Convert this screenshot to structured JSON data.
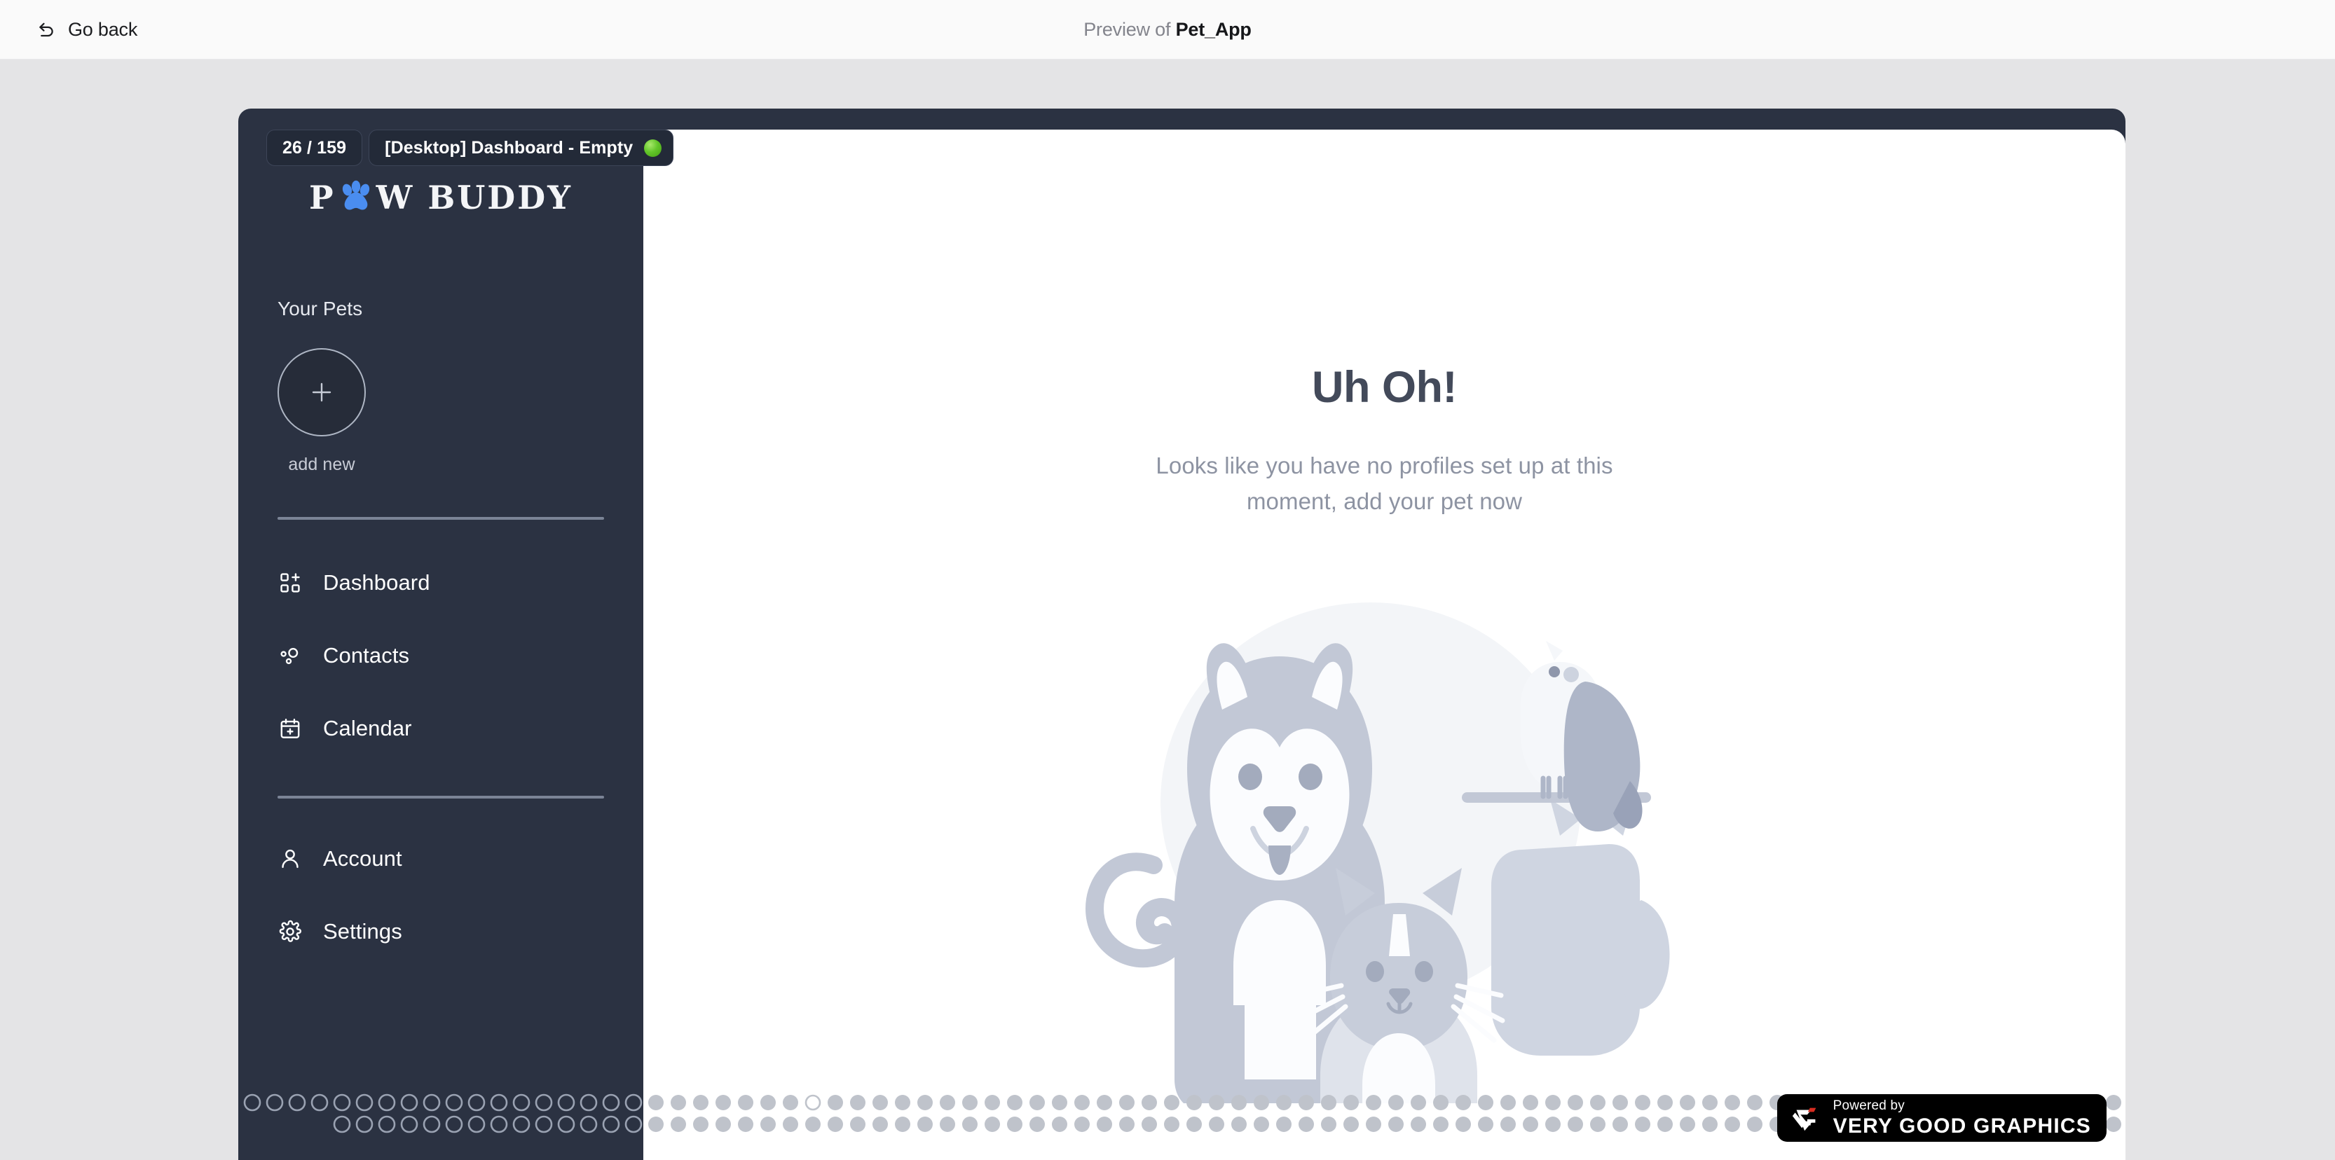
{
  "topbar": {
    "back_label": "Go back",
    "back_icon": "undo-arrow-icon",
    "preview_prefix": "Preview of ",
    "preview_app_name": "Pet_App"
  },
  "badge": {
    "counter": "26 / 159",
    "frame_name": "[Desktop] Dashboard - Empty",
    "status_dot_color": "#63c62a"
  },
  "app": {
    "logo": {
      "text_before": "P",
      "icon": "paw-icon",
      "text_after": "W BUDDY",
      "paw_color": "#4a8df0"
    },
    "sidebar": {
      "pets_section_title": "Your Pets",
      "add_new_icon": "plus-icon",
      "add_new_label": "add new",
      "nav_primary": [
        {
          "label": "Dashboard",
          "icon": "grid-plus-icon"
        },
        {
          "label": "Contacts",
          "icon": "contacts-dots-icon"
        },
        {
          "label": "Calendar",
          "icon": "calendar-plus-icon"
        }
      ],
      "nav_secondary": [
        {
          "label": "Account",
          "icon": "user-icon"
        },
        {
          "label": "Settings",
          "icon": "gear-icon"
        }
      ]
    },
    "main": {
      "empty_title": "Uh Oh!",
      "empty_description": "Looks like you have no profiles set up at this moment, add your pet now",
      "illustration": "pets-dog-cat-bird-illustration"
    }
  },
  "watermark": {
    "powered_by": "Powered by",
    "brand": "VERY GOOD GRAPHICS",
    "logo_icon": "vgg-logo-icon"
  },
  "colors": {
    "page_bg": "#e4e4e6",
    "topbar_bg": "#fafafa",
    "sidebar_bg": "#2b3242",
    "main_bg": "#ffffff",
    "accent_blue": "#4a8df0",
    "title_text": "#434a5a",
    "muted_text": "#8d93a2",
    "illustration_gray": "#c2c8d6"
  }
}
